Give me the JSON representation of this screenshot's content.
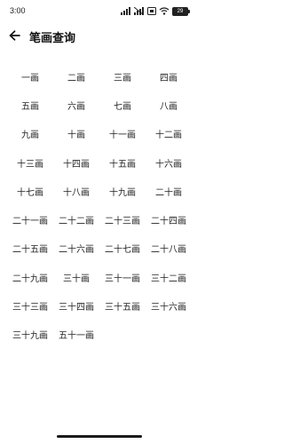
{
  "status_bar": {
    "time": "3:00",
    "battery": "29"
  },
  "header": {
    "title": "笔画查询"
  },
  "strokes": [
    "一画",
    "二画",
    "三画",
    "四画",
    "五画",
    "六画",
    "七画",
    "八画",
    "九画",
    "十画",
    "十一画",
    "十二画",
    "十三画",
    "十四画",
    "十五画",
    "十六画",
    "十七画",
    "十八画",
    "十九画",
    "二十画",
    "二十一画",
    "二十二画",
    "二十三画",
    "二十四画",
    "二十五画",
    "二十六画",
    "二十七画",
    "二十八画",
    "二十九画",
    "三十画",
    "三十一画",
    "三十二画",
    "三十三画",
    "三十四画",
    "三十五画",
    "三十六画",
    "三十九画",
    "五十一画"
  ]
}
